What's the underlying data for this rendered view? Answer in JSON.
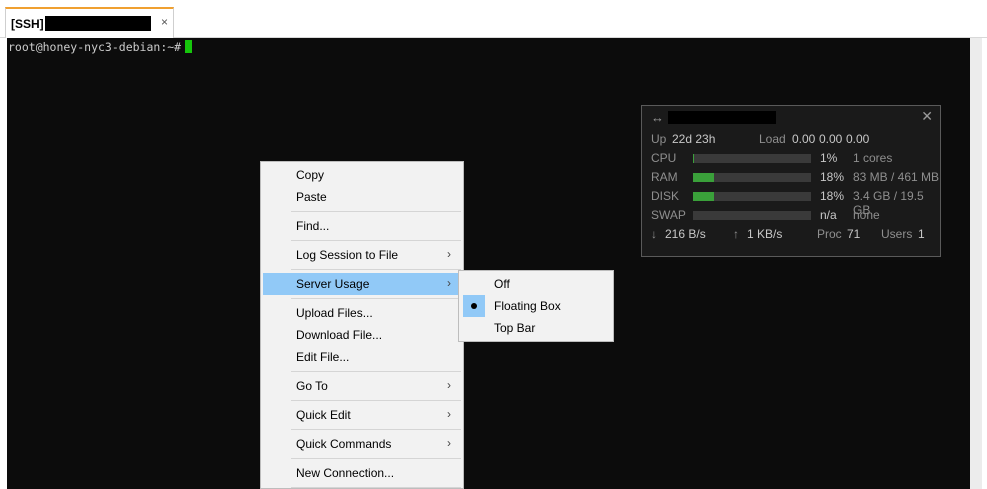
{
  "tab": {
    "label": "[SSH]",
    "close": "×"
  },
  "terminal": {
    "prompt": "root@honey-nyc3-debian:~#"
  },
  "usage": {
    "move_icon": "↔",
    "close_icon": "✕",
    "uptime_label": "Up",
    "uptime_value": "22d 23h",
    "load_label": "Load",
    "load_values": [
      "0.00",
      "0.00",
      "0.00"
    ],
    "cpu": {
      "label": "CPU",
      "percent_text": "1%",
      "level": 0.01,
      "extra": "1 cores"
    },
    "ram": {
      "label": "RAM",
      "percent_text": "18%",
      "level": 0.18,
      "extra": "83 MB / 461 MB"
    },
    "disk": {
      "label": "DISK",
      "percent_text": "18%",
      "level": 0.18,
      "extra": "3.4 GB / 19.5 GB"
    },
    "swap": {
      "label": "SWAP",
      "percent_text": "n/a",
      "level": 0,
      "extra": "none"
    },
    "down_icon": "↓",
    "down_value": "216 B/s",
    "up_icon": "↑",
    "up_value": "1 KB/s",
    "proc_label": "Proc",
    "proc_value": "71",
    "users_label": "Users",
    "users_value": "1",
    "bar_color": "#3aa03a"
  },
  "menu": {
    "copy": "Copy",
    "paste": "Paste",
    "find": "Find...",
    "log_session": "Log Session to File",
    "server_usage": "Server Usage",
    "upload": "Upload Files...",
    "download": "Download File...",
    "edit_file": "Edit File...",
    "go_to": "Go To",
    "quick_edit": "Quick Edit",
    "quick_commands": "Quick Commands",
    "new_connection": "New Connection...",
    "arrow": "›"
  },
  "submenu": {
    "off": "Off",
    "floating_box": "Floating Box",
    "top_bar": "Top Bar",
    "selected": "Floating Box"
  },
  "colors": {
    "highlight": "#91c9f7",
    "tab_accent": "#f0a030",
    "cursor": "#16c60c"
  }
}
